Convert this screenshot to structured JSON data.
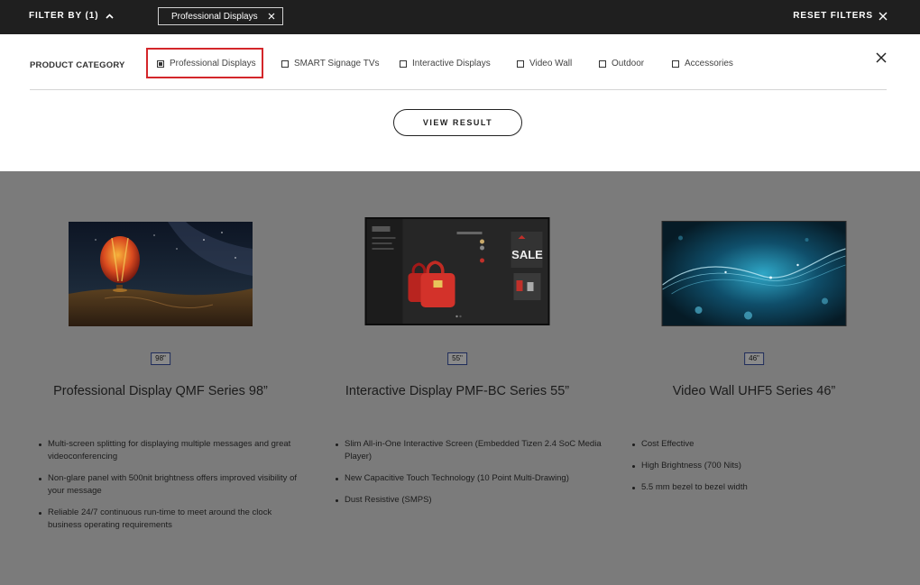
{
  "topbar": {
    "filter_by_label": "FILTER BY (1)",
    "active_filter_chip": "Professional Displays",
    "reset_label": "RESET FILTERS"
  },
  "filter_panel": {
    "category_title": "PRODUCT CATEGORY",
    "options": [
      {
        "label": "Professional Displays",
        "checked": true
      },
      {
        "label": "SMART Signage TVs",
        "checked": false
      },
      {
        "label": "Interactive Displays",
        "checked": false
      },
      {
        "label": "Video Wall",
        "checked": false
      },
      {
        "label": "Outdoor",
        "checked": false
      },
      {
        "label": "Accessories",
        "checked": false
      }
    ],
    "view_result_label": "VIEW RESULT"
  },
  "products": [
    {
      "size": "98\"",
      "title": "Professional Display QMF Series 98”",
      "features": [
        "Multi-screen splitting for displaying multiple messages and great videoconferencing",
        "Non-glare panel with 500nit brightness offers improved visibility of your message",
        "Reliable 24/7 continuous run-time to meet around the clock business operating requirements"
      ]
    },
    {
      "size": "55\"",
      "title": "Interactive Display PMF-BC Series 55”",
      "screen_text": "SALE",
      "features": [
        "Slim All-in-One Interactive Screen (Embedded Tizen 2.4 SoC Media Player)",
        "New Capacitive Touch Technology (10 Point Multi-Drawing)",
        "Dust Resistive (SMPS)"
      ]
    },
    {
      "size": "46\"",
      "title": "Video Wall UHF5 Series 46”",
      "features": [
        "Cost Effective",
        "High Brightness (700 Nits)",
        "5.5 mm bezel to bezel width"
      ]
    }
  ],
  "colors": {
    "topbar_bg": "#1f1f1f",
    "overlay_bg": "#7b7b7b",
    "highlight_red": "#d4262a",
    "badge_border": "#1e2b5a"
  }
}
